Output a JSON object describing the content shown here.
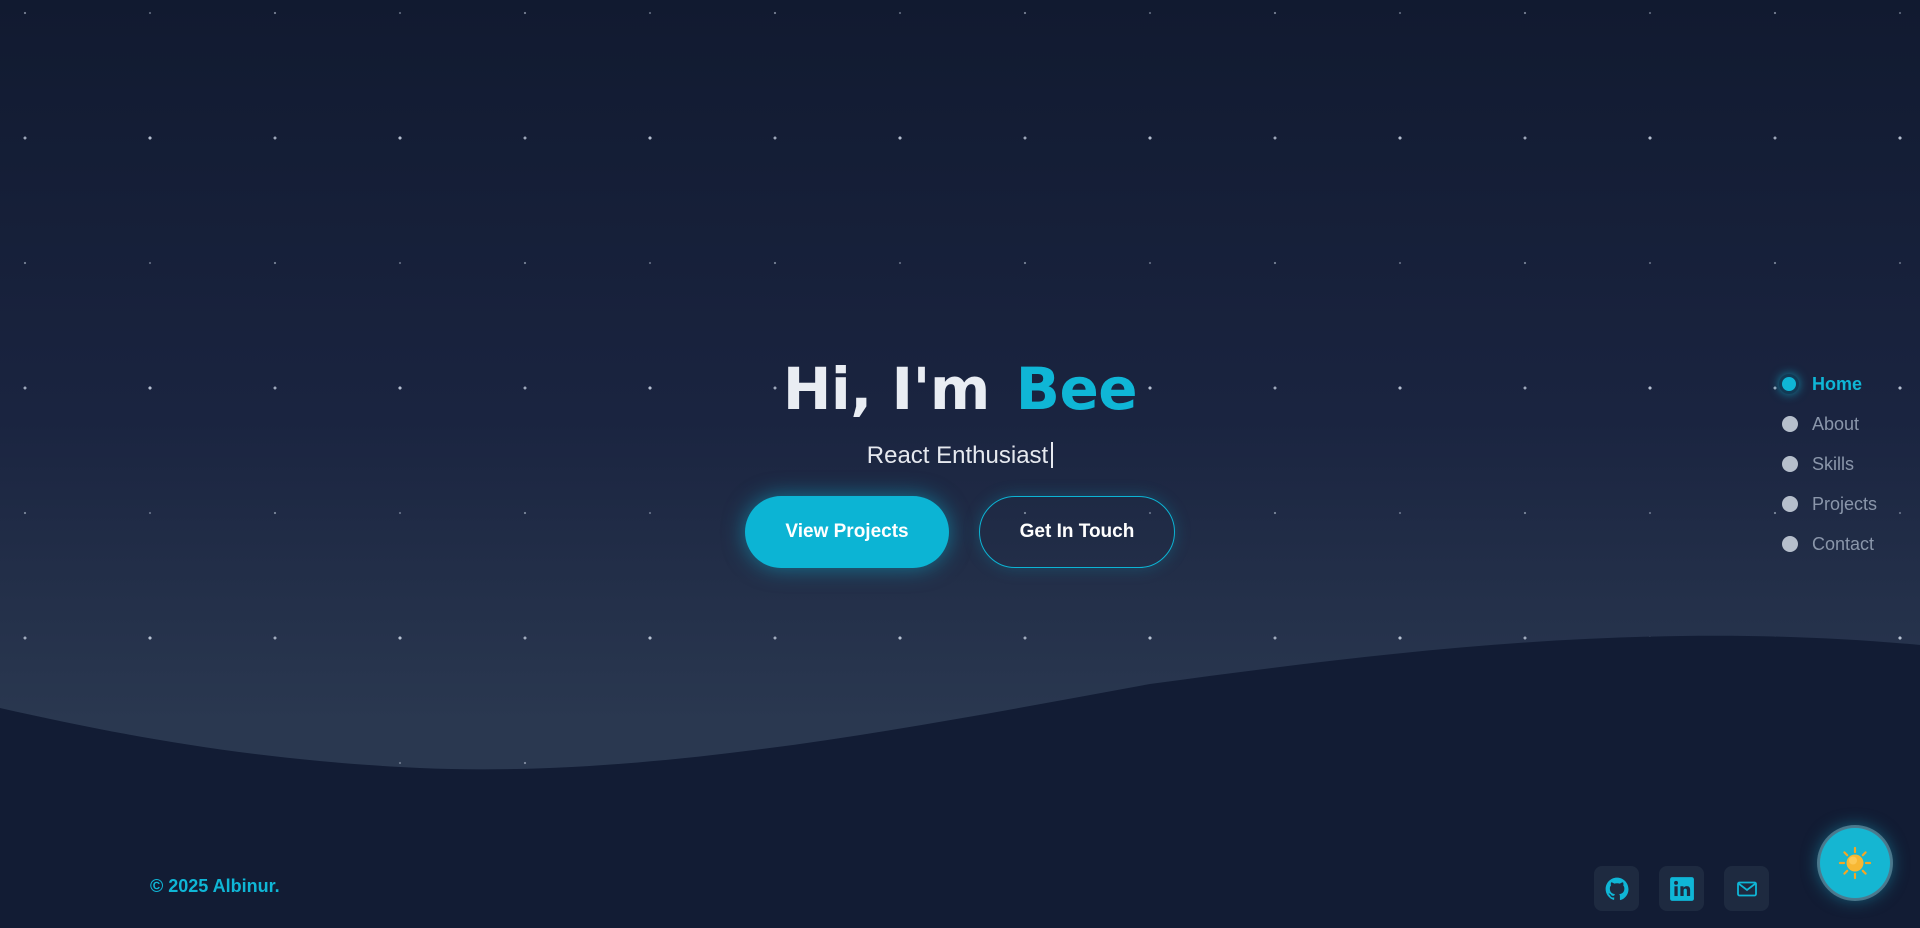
{
  "hero": {
    "greeting": "Hi, I'm",
    "name": "Bee",
    "subtitle": "React Enthusiast"
  },
  "buttons": {
    "primary_label": "View Projects",
    "secondary_label": "Get In Touch"
  },
  "nav": {
    "items": [
      {
        "label": "Home",
        "active": true
      },
      {
        "label": "About",
        "active": false
      },
      {
        "label": "Skills",
        "active": false
      },
      {
        "label": "Projects",
        "active": false
      },
      {
        "label": "Contact",
        "active": false
      }
    ]
  },
  "footer": {
    "copyright": "© 2025 Albinur.",
    "socials": [
      "github-icon",
      "linkedin-icon",
      "mail-icon"
    ]
  },
  "theme_toggle": {
    "icon": "sun-icon"
  },
  "colors": {
    "accent": "#0fb6d6",
    "background": "#121c34",
    "text": "#e6e9ef",
    "muted": "#8a96aa"
  }
}
